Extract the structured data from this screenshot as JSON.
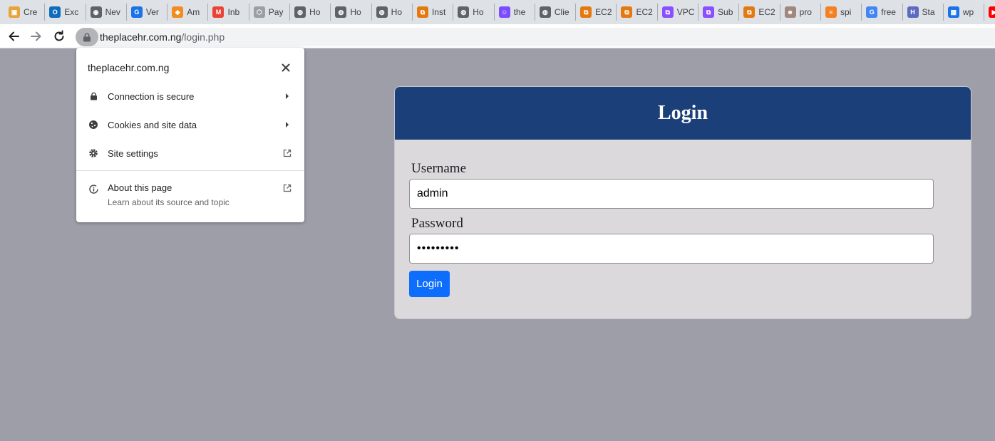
{
  "tabs": [
    {
      "title": "Cre",
      "icon": "box-icon",
      "color": "#e8a33d",
      "glyph": "▣"
    },
    {
      "title": "Exc",
      "icon": "outlook-icon",
      "color": "#0f6cbd",
      "glyph": "O"
    },
    {
      "title": "Nev",
      "icon": "chrome-icon",
      "color": "#5f6368",
      "glyph": "◉"
    },
    {
      "title": "Ver",
      "icon": "swirl-icon",
      "color": "#1a73e8",
      "glyph": "G"
    },
    {
      "title": "Am",
      "icon": "cube-icon",
      "color": "#f28b20",
      "glyph": "◆"
    },
    {
      "title": "Inb",
      "icon": "gmail-icon",
      "color": "#ea4335",
      "glyph": "M"
    },
    {
      "title": "Pay",
      "icon": "package-icon",
      "color": "#9aa0a6",
      "glyph": "⬡"
    },
    {
      "title": "Ho",
      "icon": "globe-icon",
      "color": "#5f6368",
      "glyph": "◍"
    },
    {
      "title": "Ho",
      "icon": "globe-icon",
      "color": "#5f6368",
      "glyph": "◍"
    },
    {
      "title": "Ho",
      "icon": "globe-icon",
      "color": "#5f6368",
      "glyph": "◍"
    },
    {
      "title": "Inst",
      "icon": "aws-icon",
      "color": "#e47911",
      "glyph": "⧉"
    },
    {
      "title": "Ho",
      "icon": "globe-icon",
      "color": "#5f6368",
      "glyph": "◍"
    },
    {
      "title": "the",
      "icon": "robot-icon",
      "color": "#7c4dff",
      "glyph": "☺"
    },
    {
      "title": "Clie",
      "icon": "globe-icon",
      "color": "#5f6368",
      "glyph": "◍"
    },
    {
      "title": "EC2",
      "icon": "aws-icon",
      "color": "#e47911",
      "glyph": "⧉"
    },
    {
      "title": "EC2",
      "icon": "aws-icon",
      "color": "#e47911",
      "glyph": "⧉"
    },
    {
      "title": "VPC",
      "icon": "vpc-icon",
      "color": "#8c4fff",
      "glyph": "⧉"
    },
    {
      "title": "Sub",
      "icon": "vpc-icon",
      "color": "#8c4fff",
      "glyph": "⧉"
    },
    {
      "title": "EC2",
      "icon": "aws-icon",
      "color": "#e47911",
      "glyph": "⧉"
    },
    {
      "title": "pro",
      "icon": "person-icon",
      "color": "#a1887f",
      "glyph": "☻"
    },
    {
      "title": "spi",
      "icon": "stack-icon",
      "color": "#f48024",
      "glyph": "≡"
    },
    {
      "title": "free",
      "icon": "google-icon",
      "color": "#4285f4",
      "glyph": "G"
    },
    {
      "title": "Sta",
      "icon": "h-logo-icon",
      "color": "#5c6bc0",
      "glyph": "H"
    },
    {
      "title": "wp",
      "icon": "grid-icon",
      "color": "#1a73e8",
      "glyph": "▦"
    },
    {
      "title": "",
      "icon": "youtube-icon",
      "color": "#ff0000",
      "glyph": "▶"
    }
  ],
  "toolbar": {
    "url_host": "theplacehr.com.ng",
    "url_path": "/login.php"
  },
  "site_info": {
    "domain": "theplacehr.com.ng",
    "connection_label": "Connection is secure",
    "cookies_label": "Cookies and site data",
    "settings_label": "Site settings",
    "about_title": "About this page",
    "about_subtitle": "Learn about its source and topic"
  },
  "login": {
    "title": "Login",
    "username_label": "Username",
    "username_value": "admin",
    "password_label": "Password",
    "password_value": "•••••••••",
    "button_label": "Login"
  },
  "colors": {
    "page_bg": "#9e9ea9",
    "card_header": "#1b4079",
    "card_bg": "#dbd9dc",
    "button": "#0d6efd"
  }
}
